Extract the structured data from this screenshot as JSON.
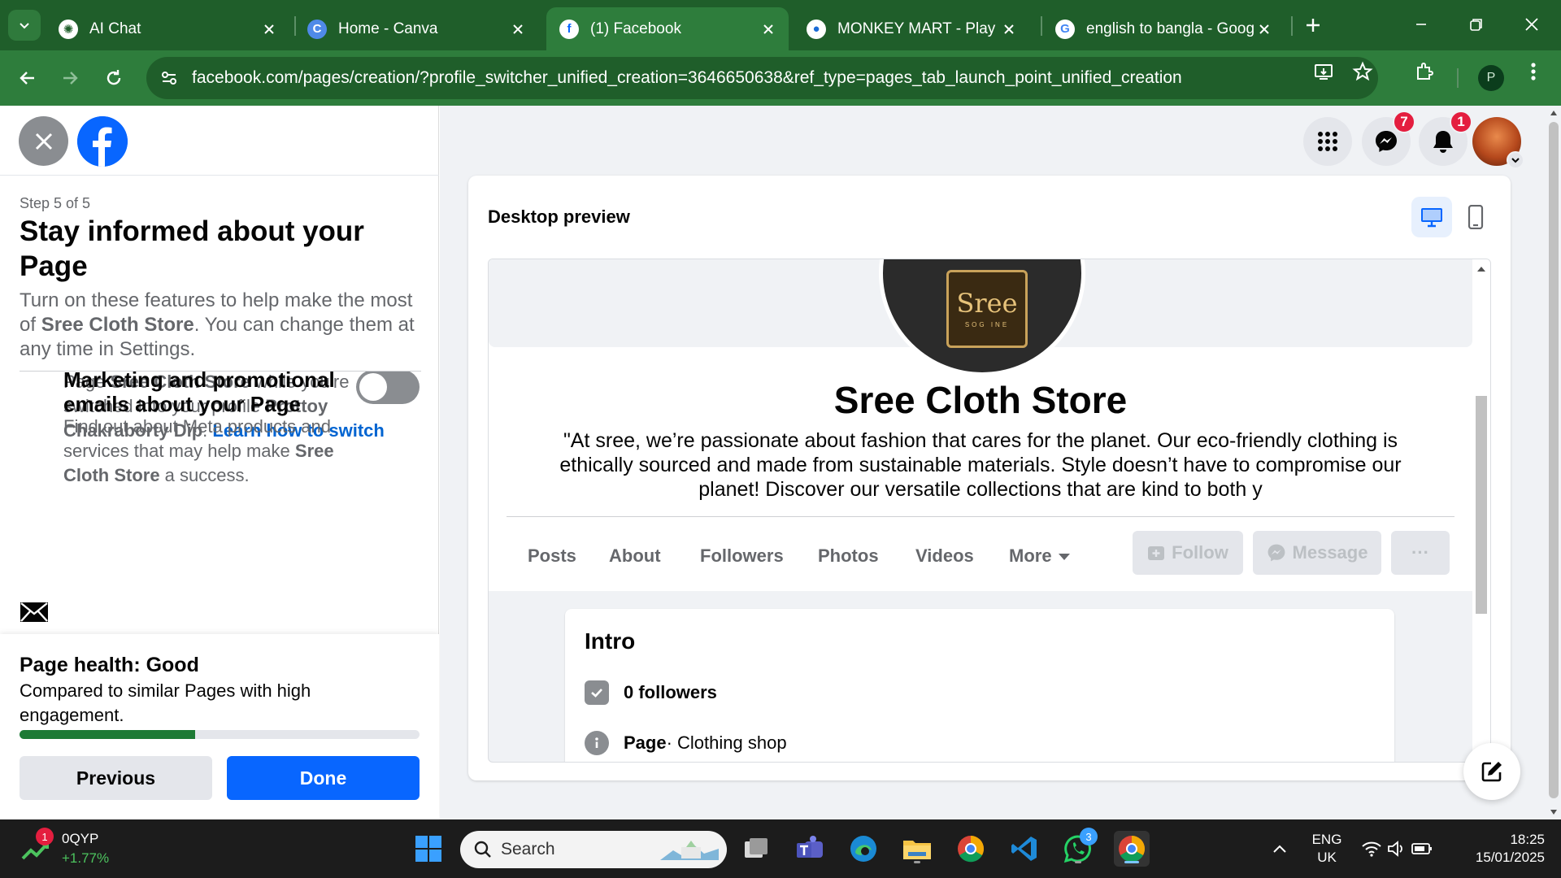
{
  "browser": {
    "tabs": [
      {
        "title": "AI Chat",
        "icon": "openai-icon"
      },
      {
        "title": "Home - Canva",
        "icon": "canva-icon"
      },
      {
        "title": "(1) Facebook",
        "icon": "facebook-icon",
        "active": true
      },
      {
        "title": "MONKEY MART - Play On",
        "icon": "poki-icon"
      },
      {
        "title": "english to bangla - Goog",
        "icon": "google-icon"
      }
    ],
    "url": "facebook.com/pages/creation/?profile_switcher_unified_creation=3646650638&ref_type=pages_tab_launch_point_unified_creation",
    "profile_initial": "P"
  },
  "left_panel": {
    "step": "Step 5 of 5",
    "heading": "Stay informed about your Page",
    "intro_prefix": "Turn on these features to help make the most of ",
    "intro_page": "Sree Cloth Store",
    "intro_suffix": ". You can change them at any time in Settings.",
    "cont_line1_prefix": "Page ",
    "cont_page": "Sree Cloth Store",
    "cont_line1_suffix": " while you're switched into your profile ",
    "cont_profile": "Prottoy Chakraborty Dip",
    "cont_link": "Learn how to switch",
    "marketing_title": "Marketing and promotional emails about your Page",
    "marketing_desc_prefix": "Find out about Meta products and services that may help make ",
    "marketing_page": "Sree Cloth Store",
    "marketing_desc_suffix": " a success.",
    "marketing_enabled": false,
    "health_title": "Page health: Good",
    "health_desc": "Compared to similar Pages with high engagement.",
    "health_progress": 0.44,
    "previous_label": "Previous",
    "done_label": "Done"
  },
  "header_icons": {
    "messenger_badge": "7",
    "notifications_badge": "1"
  },
  "preview": {
    "title": "Desktop preview",
    "logo_word": "Sree",
    "logo_sub": "SOG INE",
    "page_name": "Sree Cloth Store",
    "bio": "\"At sree, we’re passionate about fashion that cares for the planet. Our eco-friendly clothing is ethically sourced and made from sustainable materials. Style doesn’t have to compromise our planet! Discover our versatile collections that are kind to both y",
    "tabs": [
      "Posts",
      "About",
      "Followers",
      "Photos",
      "Videos",
      "More"
    ],
    "follow_label": "Follow",
    "message_label": "Message",
    "more_dots": "···",
    "intro_title": "Intro",
    "followers_text": "0 followers",
    "category_bold": "Page",
    "category_text": " · Clothing shop"
  },
  "taskbar": {
    "stock_symbol": "0QYP",
    "stock_change": "+1.77%",
    "stock_badge": "1",
    "search_label": "Search",
    "whatsapp_badge": "3",
    "lang_line1": "ENG",
    "lang_line2": "UK",
    "time": "18:25",
    "date": "15/01/2025"
  },
  "colors": {
    "chrome_dark": "#1f5e2a",
    "chrome_light": "#2e7d3c",
    "fb_blue": "#0866ff",
    "health_green": "#1d7a35"
  }
}
